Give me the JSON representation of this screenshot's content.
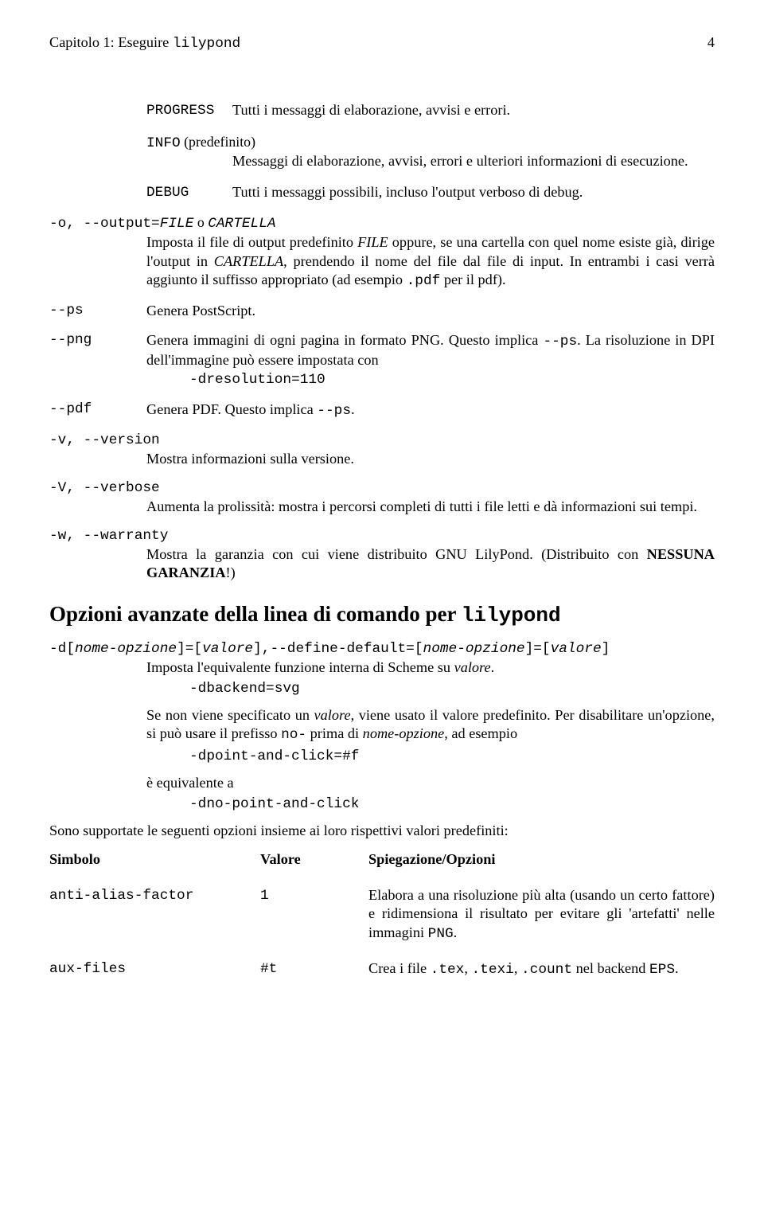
{
  "header": {
    "left_prefix": "Capitolo 1: Eseguire ",
    "left_cmd": "lilypond",
    "page_number": "4"
  },
  "levels": {
    "progress": {
      "label": "PROGRESS",
      "text": "Tutti i messaggi di elaborazione, avvisi e errori."
    },
    "info": {
      "label": "INFO",
      "suffix": " (predefinito)",
      "text": "Messaggi di elaborazione, avvisi, errori e ulteriori informazioni di esecuzione."
    },
    "debug": {
      "label": "DEBUG",
      "text": "Tutti i messaggi possibili, incluso l'output verboso di debug."
    }
  },
  "opts": {
    "output": {
      "term_pre": "-o, --output=",
      "term_file": "FILE",
      "term_or": " o ",
      "term_dir": "CARTELLA",
      "body1": "Imposta il file di output predefinito ",
      "body_file": "FILE",
      "body2": " oppure, se una cartella con quel nome esiste già, dirige l'output in ",
      "body_dir": "CARTELLA",
      "body3": ", prendendo il nome del file dal file di input. In entrambi i casi verrà aggiunto il suffisso appropriato (ad esempio ",
      "body_ext": ".pdf",
      "body4": " per il pdf)."
    },
    "ps": {
      "term": "--ps",
      "text": "Genera PostScript."
    },
    "png": {
      "term": "--png",
      "text_a": "Genera immagini di ogni pagina in formato PNG. Questo implica ",
      "text_code": "--ps",
      "text_b": ". La risoluzione in DPI dell'immagine può essere impostata con",
      "code": "-dresolution=110"
    },
    "pdf": {
      "term": "--pdf",
      "text_a": "Genera PDF. Questo implica ",
      "text_code": "--ps",
      "text_b": "."
    },
    "version": {
      "term": "-v, --version",
      "text": "Mostra informazioni sulla versione."
    },
    "verbose": {
      "term": "-V, --verbose",
      "text": "Aumenta la prolissità: mostra i percorsi completi di tutti i file letti e dà informazioni sui tempi."
    },
    "warranty": {
      "term": "-w, --warranty",
      "text_a": "Mostra la garanzia con cui viene distribuito GNU LilyPond. (Distribuito con ",
      "text_b": "NESSUNA GARANZIA",
      "text_c": "!)"
    }
  },
  "section2": {
    "heading_a": "Opzioni avanzate della linea di comando per ",
    "heading_cmd": "lilypond",
    "defterm_a": "-d[",
    "defterm_b": "nome-opzione",
    "defterm_c": "]=[",
    "defterm_d": "valore",
    "defterm_e": "],--define-default=[",
    "defterm_f": "nome-opzione",
    "defterm_g": "]=[",
    "defterm_h": "valore",
    "defterm_i": "]",
    "line1a": "Imposta l'equivalente funzione interna di Scheme su ",
    "line1b": "valore",
    "line1c": ".",
    "code1": "-dbackend=svg",
    "para2a": "Se non viene specificato un ",
    "para2b": "valore",
    "para2c": ", viene usato il valore predefinito. Per disabilitare un'opzione, si può usare il prefisso ",
    "para2d": "no-",
    "para2e": " prima di ",
    "para2f": "nome-opzione",
    "para2g": ", ad esempio",
    "code2": "-dpoint-and-click=#f",
    "eq": "è equivalente a",
    "code3": "-dno-point-and-click"
  },
  "bottom": {
    "pre": "Sono supportate le seguenti opzioni insieme ai loro rispettivi valori predefiniti:",
    "head": {
      "sym": "Simbolo",
      "val": "Valore",
      "ex": "Spiegazione/Opzioni"
    },
    "row1": {
      "sym": "anti-alias-factor",
      "val": "1",
      "ex_a": "Elabora a una risoluzione più alta (usando un certo fattore) e ridimensiona il risultato per evitare gli 'artefatti' nelle immagini ",
      "ex_code": "PNG",
      "ex_b": "."
    },
    "row2": {
      "sym": "aux-files",
      "val": "#t",
      "ex_a": "Crea i file ",
      "ex_c1": ".tex",
      "comma1": ", ",
      "ex_c2": ".texi",
      "comma2": ", ",
      "ex_c3": ".count",
      "ex_b": " nel backend ",
      "ex_c4": "EPS",
      "ex_c": "."
    }
  }
}
